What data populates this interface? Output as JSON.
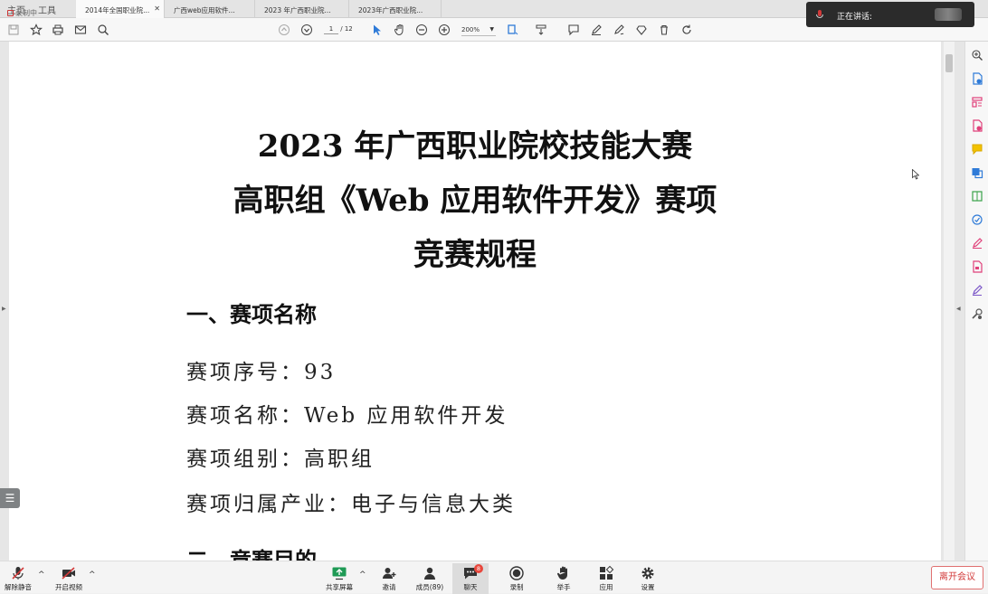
{
  "app": {
    "menu": [
      "主页",
      "工具"
    ],
    "recording_label": "录制中"
  },
  "tabs": [
    {
      "label": "2014年全国职业院...",
      "active": true
    },
    {
      "label": "广西web应用软件...",
      "active": false
    },
    {
      "label": "2023 年广西职业院...",
      "active": false
    },
    {
      "label": "2023年广西职业院...",
      "active": false
    }
  ],
  "toolbar": {
    "page_current": "1",
    "page_total": "/ 12",
    "zoom": "200%"
  },
  "document": {
    "title_lines": [
      "2023 年广西职业院校技能大赛",
      "高职组《Web 应用软件开发》赛项",
      "竞赛规程"
    ],
    "section1": "一、赛项名称",
    "lines": [
      "赛项序号：93",
      "赛项名称：Web 应用软件开发",
      "赛项组别：高职组",
      "赛项归属产业：电子与信息大类"
    ],
    "section2": "二、竞赛目的"
  },
  "speaking": {
    "label": "正在讲话:"
  },
  "meeting": {
    "mute": "解除静音",
    "video": "开启视频",
    "share": "共享屏幕",
    "invite": "邀请",
    "members": "成员(89)",
    "chat": "聊天",
    "chat_badge": "8",
    "record": "录制",
    "raise_hand": "举手",
    "apps": "应用",
    "settings": "设置",
    "leave": "离开会议"
  },
  "colors": {
    "accent_red": "#d23a3a",
    "sidebar_blue": "#2f7bd8",
    "sidebar_pink": "#e0407a"
  }
}
